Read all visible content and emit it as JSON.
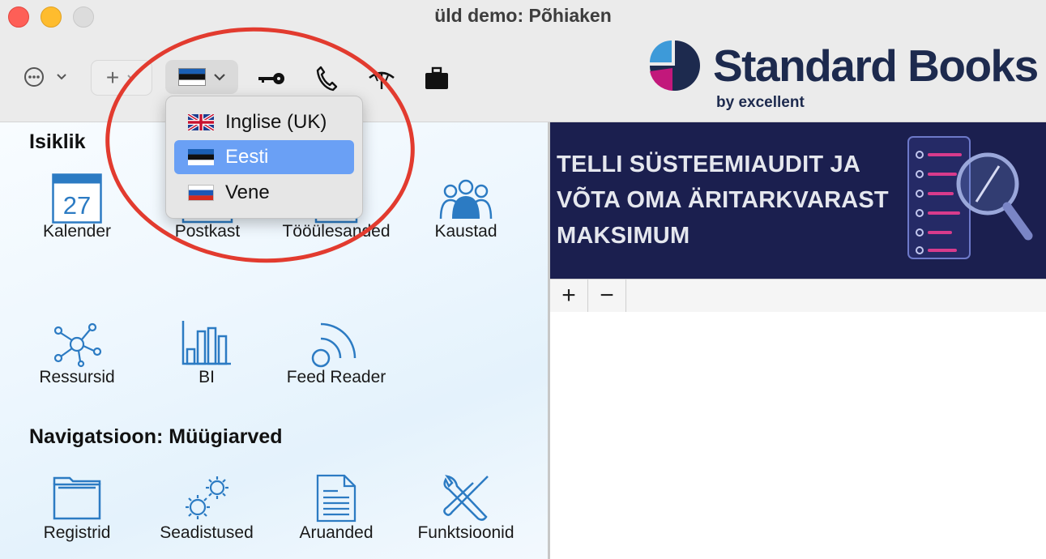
{
  "window": {
    "title": "üld demo: Põhiaken"
  },
  "toolbar": {
    "more_icon": "ellipsis-circle-icon",
    "add_label": "+",
    "language_flag": "estonia-flag-icon",
    "tools": [
      "key-icon",
      "phone-icon",
      "antenna-icon",
      "briefcase-icon"
    ]
  },
  "logo": {
    "name": "Standard Books",
    "sub": "by excellent",
    "colors": {
      "navy": "#1d2a4e",
      "magenta": "#c2187b",
      "blue": "#3d9ad9"
    }
  },
  "language_menu": {
    "items": [
      {
        "label": "Inglise (UK)",
        "flag": "uk-flag-icon",
        "selected": false
      },
      {
        "label": "Eesti",
        "flag": "estonia-flag-icon",
        "selected": true
      },
      {
        "label": "Vene",
        "flag": "russia-flag-icon",
        "selected": false
      }
    ],
    "highlight_color": "#6aa0f5"
  },
  "personal": {
    "title": "Isiklik",
    "calendar_day": "27",
    "items": [
      {
        "label": "Kalender",
        "icon": "calendar-icon"
      },
      {
        "label": "Postkast",
        "icon": "mailbox-icon"
      },
      {
        "label": "Tööülesanded",
        "icon": "tasks-icon"
      },
      {
        "label": "Kaustad",
        "icon": "people-group-icon"
      },
      {
        "label": "Ressursid",
        "icon": "network-nodes-icon"
      },
      {
        "label": "BI",
        "icon": "bar-chart-icon"
      },
      {
        "label": "Feed Reader",
        "icon": "rss-feed-icon"
      }
    ]
  },
  "navigation": {
    "title": "Navigatsioon: Müügiarved",
    "items": [
      {
        "label": "Registrid",
        "icon": "folder-icon"
      },
      {
        "label": "Seadistused",
        "icon": "gears-icon"
      },
      {
        "label": "Aruanded",
        "icon": "report-document-icon"
      },
      {
        "label": "Funktsioonid",
        "icon": "tools-icon"
      }
    ]
  },
  "banner": {
    "lines": [
      "TELLI SÜSTEEMIAUDIT JA",
      "VÕTA OMA ÄRITARKVARAST",
      "MAKSIMUM"
    ],
    "colors": {
      "background": "#1b1f4f",
      "accent": "#d83b8c"
    }
  },
  "right_panel": {
    "add_label": "+",
    "remove_label": "−"
  },
  "annotation": {
    "color": "#e23b2f"
  }
}
